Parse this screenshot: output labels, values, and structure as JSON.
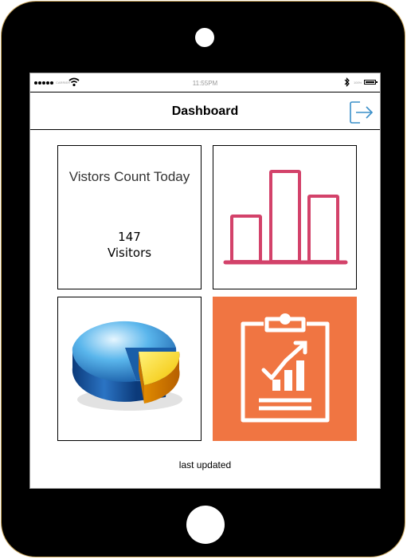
{
  "status_bar": {
    "carrier": "CARRIER",
    "time": "11:55PM",
    "battery_percent": "100%",
    "icons": [
      "signal-dots-icon",
      "wifi-icon",
      "bluetooth-icon",
      "battery-icon"
    ]
  },
  "header": {
    "title": "Dashboard",
    "logout_icon": "logout-icon"
  },
  "tiles": {
    "visitors": {
      "title": "Vistors Count Today",
      "count": "147",
      "unit": "Visitors"
    },
    "bar_chart": {
      "icon": "bar-chart-icon",
      "color": "#d3426a"
    },
    "pie_chart": {
      "icon": "pie-chart-3d-icon"
    },
    "report": {
      "icon": "clipboard-report-icon",
      "background": "#f07542"
    }
  },
  "footer": {
    "last_updated": "last updated"
  },
  "colors": {
    "device": "#000000",
    "accent_blue": "#3a8fc9",
    "accent_pink": "#d3426a",
    "accent_orange": "#f07542"
  }
}
